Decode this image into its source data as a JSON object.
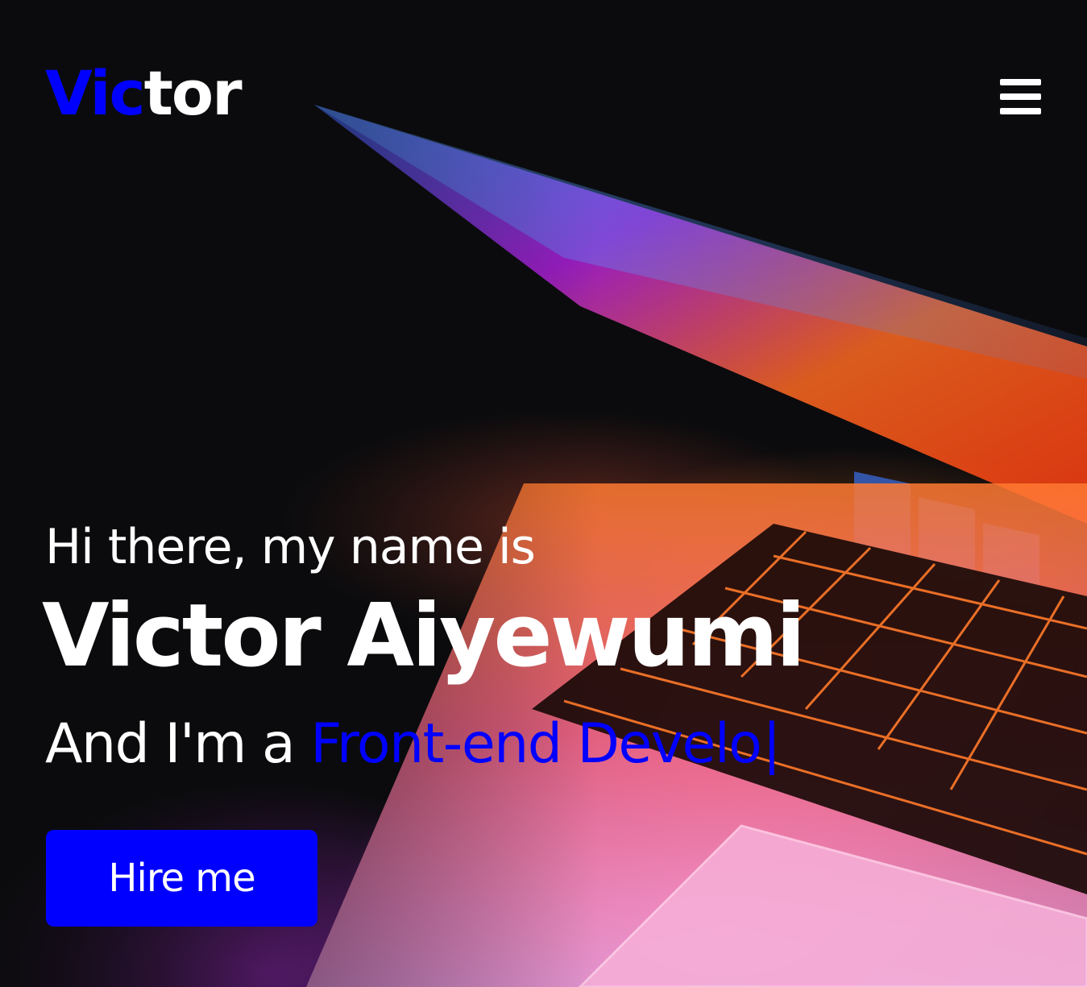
{
  "nav": {
    "logo_accent": "Vic",
    "logo_rest": "tor",
    "menu_icon": "hamburger-menu-icon"
  },
  "hero": {
    "greeting": "Hi there, my name is",
    "name": "Victor Aiyewumi",
    "role_prefix": "And I'm a ",
    "role_typed": "Front-end Develo",
    "cursor": "|",
    "cta_label": "Hire me",
    "background_image": "laptop-keyboard-photo"
  },
  "colors": {
    "accent": "#0000ff",
    "text": "#ffffff",
    "background": "#0b0b0d"
  }
}
